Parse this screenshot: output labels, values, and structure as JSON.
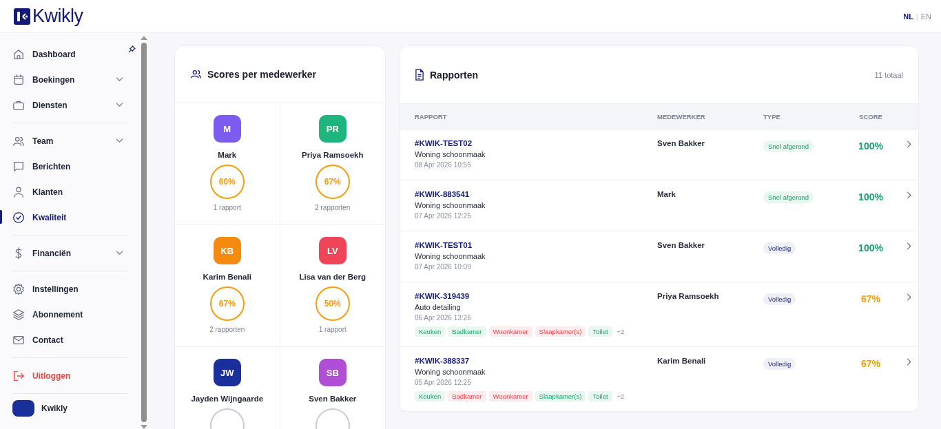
{
  "header": {
    "logo": "Kwikly",
    "languages": [
      {
        "label": "NL",
        "selected": true
      },
      {
        "label": "EN",
        "selected": false
      }
    ],
    "separator": "|"
  },
  "sidebar": {
    "sections": [
      {
        "items": [
          {
            "label": "Dashboard",
            "expandable": false,
            "selected": false,
            "kind": "normal"
          },
          {
            "label": "Boekingen",
            "expandable": true,
            "selected": false,
            "kind": "normal"
          },
          {
            "label": "Diensten",
            "expandable": true,
            "selected": false,
            "kind": "normal"
          }
        ]
      },
      {
        "items": [
          {
            "label": "Team",
            "expandable": true,
            "selected": false,
            "kind": "normal"
          },
          {
            "label": "Berichten",
            "expandable": false,
            "selected": false,
            "kind": "normal"
          },
          {
            "label": "Klanten",
            "expandable": false,
            "selected": false,
            "kind": "normal"
          },
          {
            "label": "Kwaliteit",
            "expandable": false,
            "selected": true,
            "kind": "normal"
          }
        ]
      },
      {
        "items": [
          {
            "label": "Financiën",
            "expandable": true,
            "selected": false,
            "kind": "normal"
          }
        ]
      },
      {
        "items": [
          {
            "label": "Instellingen",
            "expandable": false,
            "selected": false,
            "kind": "normal"
          },
          {
            "label": "Abonnement",
            "expandable": false,
            "selected": false,
            "kind": "normal"
          },
          {
            "label": "Contact",
            "expandable": false,
            "selected": false,
            "kind": "normal"
          }
        ]
      },
      {
        "items": [
          {
            "label": "Uitloggen",
            "expandable": false,
            "selected": false,
            "kind": "logout"
          }
        ]
      }
    ],
    "account": {
      "name": "Kwikly"
    }
  },
  "scores": {
    "title": "Scores per medewerker",
    "employees": [
      {
        "initials": "M",
        "name": "Mark",
        "color": "#7c5cf0",
        "score": "60%",
        "kind": "warn",
        "reports": "1 rapport"
      },
      {
        "initials": "PR",
        "name": "Priya Ramsoekh",
        "color": "#1fb57f",
        "score": "67%",
        "kind": "warn",
        "reports": "2 rapporten"
      },
      {
        "initials": "KB",
        "name": "Karim Benali",
        "color": "#f58a10",
        "score": "67%",
        "kind": "warn",
        "reports": "2 rapporten"
      },
      {
        "initials": "LV",
        "name": "Lisa van der Berg",
        "color": "#ee4558",
        "score": "50%",
        "kind": "warn",
        "reports": "1 rapport"
      },
      {
        "initials": "JW",
        "name": "Jayden Wijngaarde",
        "color": "#1a2f9a",
        "kind": "empty"
      },
      {
        "initials": "SB",
        "name": "Sven Bakker",
        "color": "#b04fd6",
        "kind": "empty"
      }
    ]
  },
  "reports": {
    "title": "Rapporten",
    "total": "11 totaal",
    "columns": [
      "RAPPORT",
      "MEDEWERKER",
      "TYPE",
      "SCORE"
    ],
    "rows": [
      {
        "id": "#KWIK-TEST02",
        "service": "Woning schoonmaak",
        "date": "08 Apr 2026 10:55",
        "employee": "Sven Bakker",
        "type": {
          "label": "Snel afgerond",
          "kind": "quick"
        },
        "score": "100%",
        "kind": "good"
      },
      {
        "id": "#KWIK-883541",
        "service": "Woning schoonmaak",
        "date": "07 Apr 2026 12:25",
        "employee": "Mark",
        "type": {
          "label": "Snel afgerond",
          "kind": "quick"
        },
        "score": "100%",
        "kind": "good"
      },
      {
        "id": "#KWIK-TEST01",
        "service": "Woning schoonmaak",
        "date": "07 Apr 2026 10:09",
        "employee": "Sven Bakker",
        "type": {
          "label": "Volledig",
          "kind": "full"
        },
        "score": "100%",
        "kind": "good"
      },
      {
        "id": "#KWIK-319439",
        "service": "Auto detailing",
        "date": "06 Apr 2026 13:25",
        "employee": "Priya Ramsoekh",
        "type": {
          "label": "Volledig",
          "kind": "full"
        },
        "score": "67%",
        "kind": "warn",
        "tags": [
          {
            "label": "Keuken",
            "ok": true
          },
          {
            "label": "Badkamer",
            "ok": true
          },
          {
            "label": "Woonkamer",
            "ok": false
          },
          {
            "label": "Slaapkamer(s)",
            "ok": false
          },
          {
            "label": "Toilet",
            "ok": true
          }
        ],
        "more": "+2"
      },
      {
        "id": "#KWIK-388337",
        "service": "Woning schoonmaak",
        "date": "05 Apr 2026 12:25",
        "employee": "Karim Benali",
        "type": {
          "label": "Volledig",
          "kind": "full"
        },
        "score": "67%",
        "kind": "warn",
        "tags": [
          {
            "label": "Keuken",
            "ok": true
          },
          {
            "label": "Badkamer",
            "ok": false
          },
          {
            "label": "Woonkamer",
            "ok": false
          },
          {
            "label": "Slaapkamer(s)",
            "ok": true
          },
          {
            "label": "Toilet",
            "ok": true
          }
        ],
        "more": "+2"
      }
    ]
  }
}
